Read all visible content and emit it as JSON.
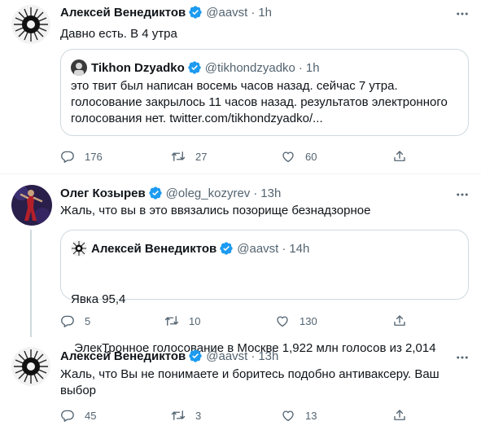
{
  "tweets": [
    {
      "author_name": "Алексей Венедиктов",
      "author_handle": "@aavst",
      "separator": "·",
      "time": "1h",
      "text": "Давно есть. В 4 утра",
      "quote": {
        "author_name": "Tikhon Dzyadko",
        "author_handle": "@tikhondzyadko",
        "separator": "·",
        "time": "1h",
        "lines": [
          "это твит был написан восемь часов назад. сейчас 7 утра.",
          "голосование закрылось 11 часов назад. результатов электронного",
          "голосования нет. twitter.com/tikhondzyadko/..."
        ]
      },
      "replies": "176",
      "retweets": "27",
      "likes": "60"
    },
    {
      "author_name": "Олег Козырев",
      "author_handle": "@oleg_kozyrev",
      "separator": "·",
      "time": "13h",
      "text": "Жаль, что вы в это ввязались позорище безнадзорное",
      "quote": {
        "author_name": "Алексей Венедиктов",
        "author_handle": "@aavst",
        "separator": "·",
        "time": "14h",
        "lines": [
          "Явка 95,4",
          " ЭлекТронное голосование в Москве 1,922 млн голосов из 2,014"
        ]
      },
      "replies": "5",
      "retweets": "10",
      "likes": "130"
    },
    {
      "author_name": "Алексей Венедиктов",
      "author_handle": "@aavst",
      "separator": "·",
      "time": "13h",
      "lines": [
        "Жаль, что Вы не понимаете и боритесь подобно антиваксеру. Ваш",
        "выбор"
      ],
      "replies": "45",
      "retweets": "3",
      "likes": "13"
    }
  ],
  "colors": {
    "verified": "#1d9bf0",
    "secondary_text": "#536471",
    "border": "#cfd9de"
  },
  "icons": [
    "verified-badge-icon",
    "more-options-icon",
    "reply-icon",
    "retweet-icon",
    "like-icon",
    "share-icon"
  ]
}
